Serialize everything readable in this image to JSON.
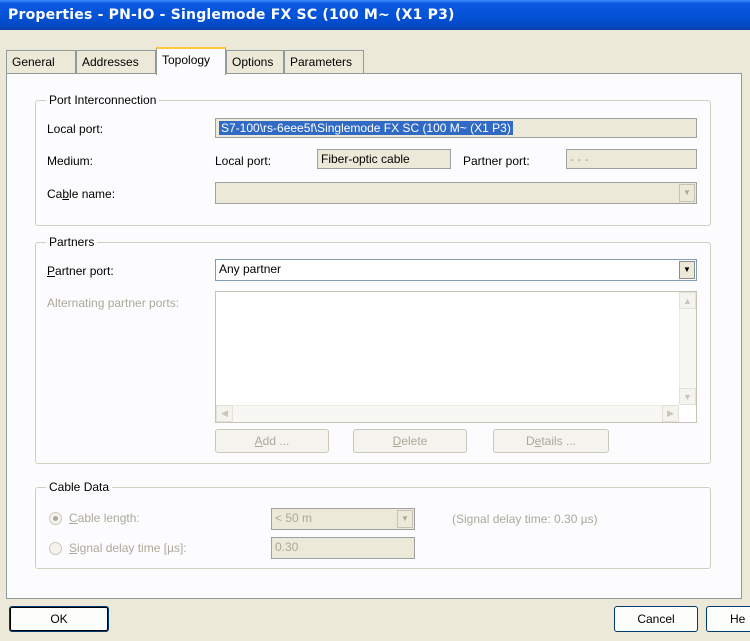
{
  "window": {
    "title": "Properties - PN-IO - Singlemode FX SC (100 M~ (X1 P3)"
  },
  "tabs": [
    {
      "label": "General"
    },
    {
      "label": "Addresses"
    },
    {
      "label": "Topology"
    },
    {
      "label": "Options"
    },
    {
      "label": "Parameters"
    }
  ],
  "port_interconnection": {
    "title": "Port Interconnection",
    "local_port_label": "Local port:",
    "local_port_value": "S7-100\\rs-6eee5f\\Singlemode FX SC (100 M~ (X1 P3)",
    "medium_label": "Medium:",
    "medium_local_port_label": "Local port:",
    "medium_local_port_value": "Fiber-optic cable",
    "partner_port_label": "Partner port:",
    "partner_port_value": "- - -",
    "cable_name_label_pre": "Ca",
    "cable_name_label_u": "b",
    "cable_name_label_post": "le name:",
    "cable_name_value": ""
  },
  "partners": {
    "title": "Partners",
    "partner_port_label_u": "P",
    "partner_port_label_post": "artner port:",
    "partner_port_value": "Any partner",
    "alternating_label": "Alternating partner ports:",
    "add_button_u": "A",
    "add_button_post": "dd ...",
    "delete_button_u": "D",
    "delete_button_post": "elete",
    "details_button_pre": "D",
    "details_button_u": "e",
    "details_button_post": "tails ..."
  },
  "cable_data": {
    "title": "Cable Data",
    "cable_length_label_u": "C",
    "cable_length_label_post": "able length:",
    "cable_length_value": "< 50 m",
    "signal_delay_note": "(Signal delay time: 0.30 µs)",
    "signal_delay_label_u": "S",
    "signal_delay_label_post": "ignal delay time [µs]:",
    "signal_delay_value": "0.30"
  },
  "footer": {
    "ok_label": "OK",
    "cancel_label": "Cancel",
    "help_label": "He"
  },
  "colors": {
    "titlebar": "#0553d8",
    "dialog_bg": "#ece9d8",
    "selection": "#316ac5"
  }
}
